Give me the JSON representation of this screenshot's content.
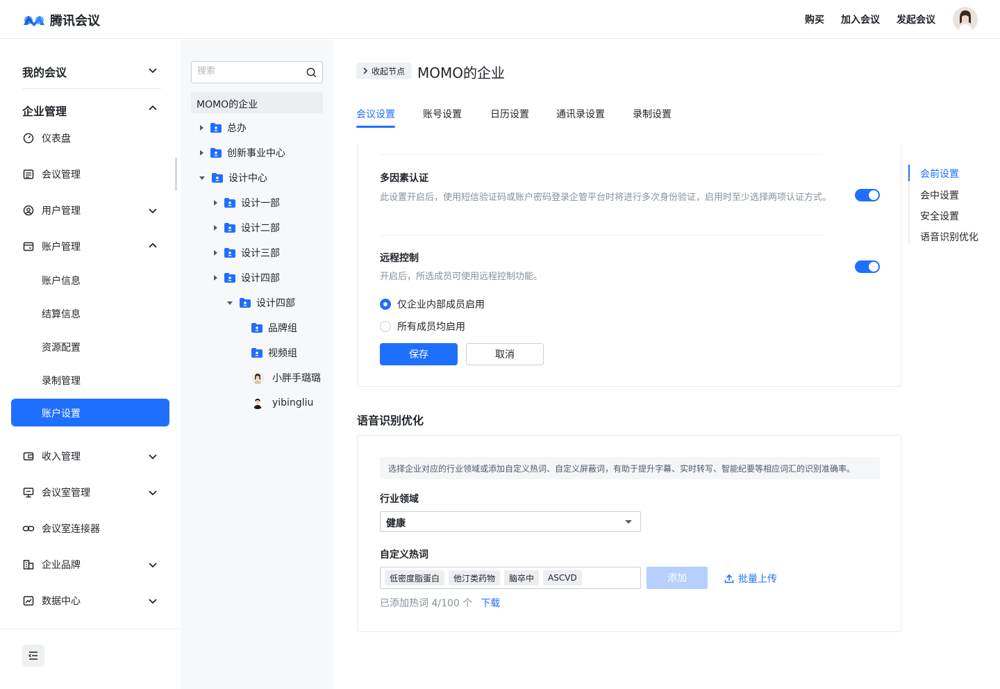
{
  "header": {
    "logo_text": "腾讯会议",
    "nav": [
      "购买",
      "加入会议",
      "发起会议"
    ]
  },
  "sidebar": {
    "my_meetings": "我的会议",
    "enterprise": "企业管理",
    "items": [
      {
        "label": "仪表盘",
        "icon": "dashboard-icon"
      },
      {
        "label": "会议管理",
        "icon": "list-icon"
      },
      {
        "label": "用户管理",
        "icon": "user-circle-icon"
      },
      {
        "label": "账户管理",
        "icon": "wallet-icon"
      },
      {
        "label": "收入管理",
        "icon": "income-icon"
      },
      {
        "label": "会议室管理",
        "icon": "meeting-room-icon"
      },
      {
        "label": "会议室连接器",
        "icon": "link-icon"
      },
      {
        "label": "企业品牌",
        "icon": "building-icon"
      },
      {
        "label": "数据中心",
        "icon": "chart-icon"
      }
    ],
    "account_sub": [
      "账户信息",
      "结算信息",
      "资源配置",
      "录制管理",
      "账户设置"
    ],
    "active": "账户设置"
  },
  "tree": {
    "search_placeholder": "搜索",
    "root": "MOMO的企业",
    "nodes": [
      "总办",
      "创新事业中心",
      "设计中心",
      "设计一部",
      "设计二部",
      "设计三部",
      "设计四部",
      "设计四部",
      "品牌组",
      "视频组",
      "小胖手璐璐",
      "yibingliu"
    ]
  },
  "main": {
    "collapse_label": "收起节点",
    "org_title": "MOMO的企业",
    "tabs": [
      "会议设置",
      "账号设置",
      "日历设置",
      "通讯录设置",
      "录制设置"
    ],
    "active_tab": "会议设置",
    "mfa": {
      "title": "多因素认证",
      "desc": "此设置开启后，使用短信验证码或账户密码登录企管平台时将进行多次身份验证，启用时至少选择两项认证方式。",
      "enabled": true
    },
    "remote": {
      "title": "远程控制",
      "desc": "开启后，所选成员可使用远程控制功能。",
      "enabled": true,
      "options": [
        "仅企业内部成员启用",
        "所有成员均启用"
      ],
      "selected": "仅企业内部成员启用",
      "save": "保存",
      "cancel": "取消"
    },
    "asr": {
      "section_title": "语音识别优化",
      "tip": "选择企业对应的行业领域或添加自定义热词、自定义屏蔽词，有助于提升字幕、实时转写、智能纪要等相应词汇的识别准确率。",
      "industry_label": "行业领域",
      "industry_value": "健康",
      "hotword_label": "自定义热词",
      "tags": [
        "低密度脂蛋白",
        "他汀类药物",
        "脑卒中",
        "ASCVD"
      ],
      "add": "添加",
      "upload": "批量上传",
      "count_text": "已添加热词 4/100 个",
      "download": "下载"
    },
    "anchors": [
      "会前设置",
      "会中设置",
      "安全设置",
      "语音识别优化"
    ],
    "active_anchor": "会前设置"
  },
  "colors": {
    "accent": "#1f6fff"
  }
}
